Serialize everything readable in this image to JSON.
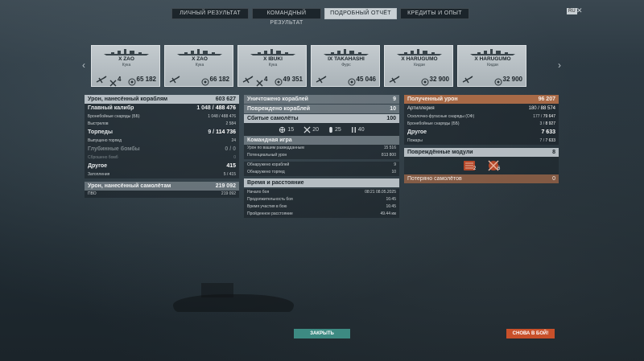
{
  "tabs": [
    {
      "label": "ЛИЧНЫЙ РЕЗУЛЬТАТ"
    },
    {
      "label": "КОМАНДНЫЙ РЕЗУЛЬТАТ"
    },
    {
      "label": "ПОДРОБНЫЙ ОТЧЁТ"
    },
    {
      "label": "КРЕДИТЫ И ОПЫТ"
    }
  ],
  "active_tab": 2,
  "region_badge": "RU",
  "close_glyph": "✕",
  "ships": [
    {
      "name": "X ZAO",
      "player": "Кука",
      "kills": "4",
      "damage": "65 182"
    },
    {
      "name": "X ZAO",
      "player": "Кука",
      "kills": "",
      "damage": "66 182"
    },
    {
      "name": "X IBUKI",
      "player": "Кука",
      "kills": "4",
      "damage": "49 351"
    },
    {
      "name": "IX TAKAHASHI",
      "player": "Фурс",
      "kills": "",
      "damage": "45 046"
    },
    {
      "name": "X HARUGUMO",
      "player": "Кидзи",
      "kills": "",
      "damage": "32 900"
    },
    {
      "name": "X HARUGUMO",
      "player": "Кидзи",
      "kills": "",
      "damage": "32 900"
    }
  ],
  "left": {
    "ships_damage": {
      "label": "Урон, нанесённый кораблям",
      "value": "603 627"
    },
    "main_battery": {
      "label": "Главный калибр",
      "value_a": "1 048",
      "value_b": "488 476"
    },
    "ap_shells": {
      "label": "Бронебойные снаряды (ББ)",
      "value": "1 048 / 488 476"
    },
    "shots": {
      "label": "Выстрелов",
      "value": "2 584"
    },
    "torpedoes": {
      "label": "Торпеды",
      "value_a": "9",
      "value_b": "114 736"
    },
    "torp_fired": {
      "label": "Выпущено торпед",
      "value": "24"
    },
    "depth": {
      "label": "Глубинные бомбы",
      "value": "0 / 0"
    },
    "depth_dropped": {
      "label": "Сброшено бомб",
      "value": "0"
    },
    "other": {
      "label": "Другое",
      "value": "415"
    },
    "flooding": {
      "label": "Затопления",
      "value": "5 / 415"
    },
    "planes_damage": {
      "label": "Урон, нанесённый самолётам",
      "value": "219 092"
    },
    "aa": {
      "label": "ПВО",
      "value": "219 092"
    }
  },
  "middle": {
    "destroyed": {
      "label": "Уничтожено кораблей",
      "value": "9"
    },
    "damaged": {
      "label": "Повреждено кораблей",
      "value": "10"
    },
    "planes_down": {
      "label": "Сбитые самолёты",
      "value": "100"
    },
    "plane_icons": [
      {
        "icon": "torpedo-bomber-icon",
        "value": "15"
      },
      {
        "icon": "fighter-icon",
        "value": "20"
      },
      {
        "icon": "bomber-icon",
        "value": "25"
      },
      {
        "icon": "rocket-icon",
        "value": "40"
      }
    ],
    "team_play": {
      "label": "Командная игра"
    },
    "spotting_damage": {
      "label": "Урон по вашим разведданным",
      "value": "15 516"
    },
    "potential_damage": {
      "label": "Потенциальный урон",
      "value": "813 800"
    },
    "spotted_ships": {
      "label": "Обнаружено кораблей",
      "value": "9"
    },
    "spotted_torps": {
      "label": "Обнаружено торпед",
      "value": "10"
    },
    "time_distance": {
      "label": "Время и расстояние"
    },
    "battle_start": {
      "label": "Начало боя",
      "value": "08:21  08.05.2025"
    },
    "battle_duration": {
      "label": "Продолжительность боя",
      "value": "16:45"
    },
    "time_in_battle": {
      "label": "Время участия в бою",
      "value": "16:45"
    },
    "distance": {
      "label": "Пройденное расстояние",
      "value": "49.44 км"
    }
  },
  "right": {
    "received": {
      "label": "Полученный урон",
      "value": "96 207"
    },
    "artillery": {
      "label": "Артиллерия",
      "value_a": "180",
      "value_b": "88 574"
    },
    "he_shells": {
      "label": "Осколочно-фугасные снаряды (ОФ)",
      "value_a": "177",
      "value_b": "79 647"
    },
    "ap_shells": {
      "label": "Бронебойные снаряды (ББ)",
      "value_a": "3",
      "value_b": "8 927"
    },
    "other": {
      "label": "Другое",
      "value": "7 633"
    },
    "fires": {
      "label": "Пожары",
      "value_a": "7",
      "value_b": "7 633"
    },
    "modules": {
      "label": "Повреждённые модули",
      "value": "8"
    },
    "module_icons": [
      {
        "icon": "engine-module-icon",
        "value": "2"
      },
      {
        "icon": "steering-module-icon",
        "value": "6"
      }
    ],
    "lost_planes": {
      "label": "Потеряно самолётов",
      "value": "0"
    }
  },
  "buttons": {
    "close": "ЗАКРЫТЬ",
    "battle": "СНОВА В БОЙ!"
  },
  "colors": {
    "accent_orange": "#c8502a",
    "teal": "#3d8a82",
    "panel_orange": "#a86a47"
  }
}
